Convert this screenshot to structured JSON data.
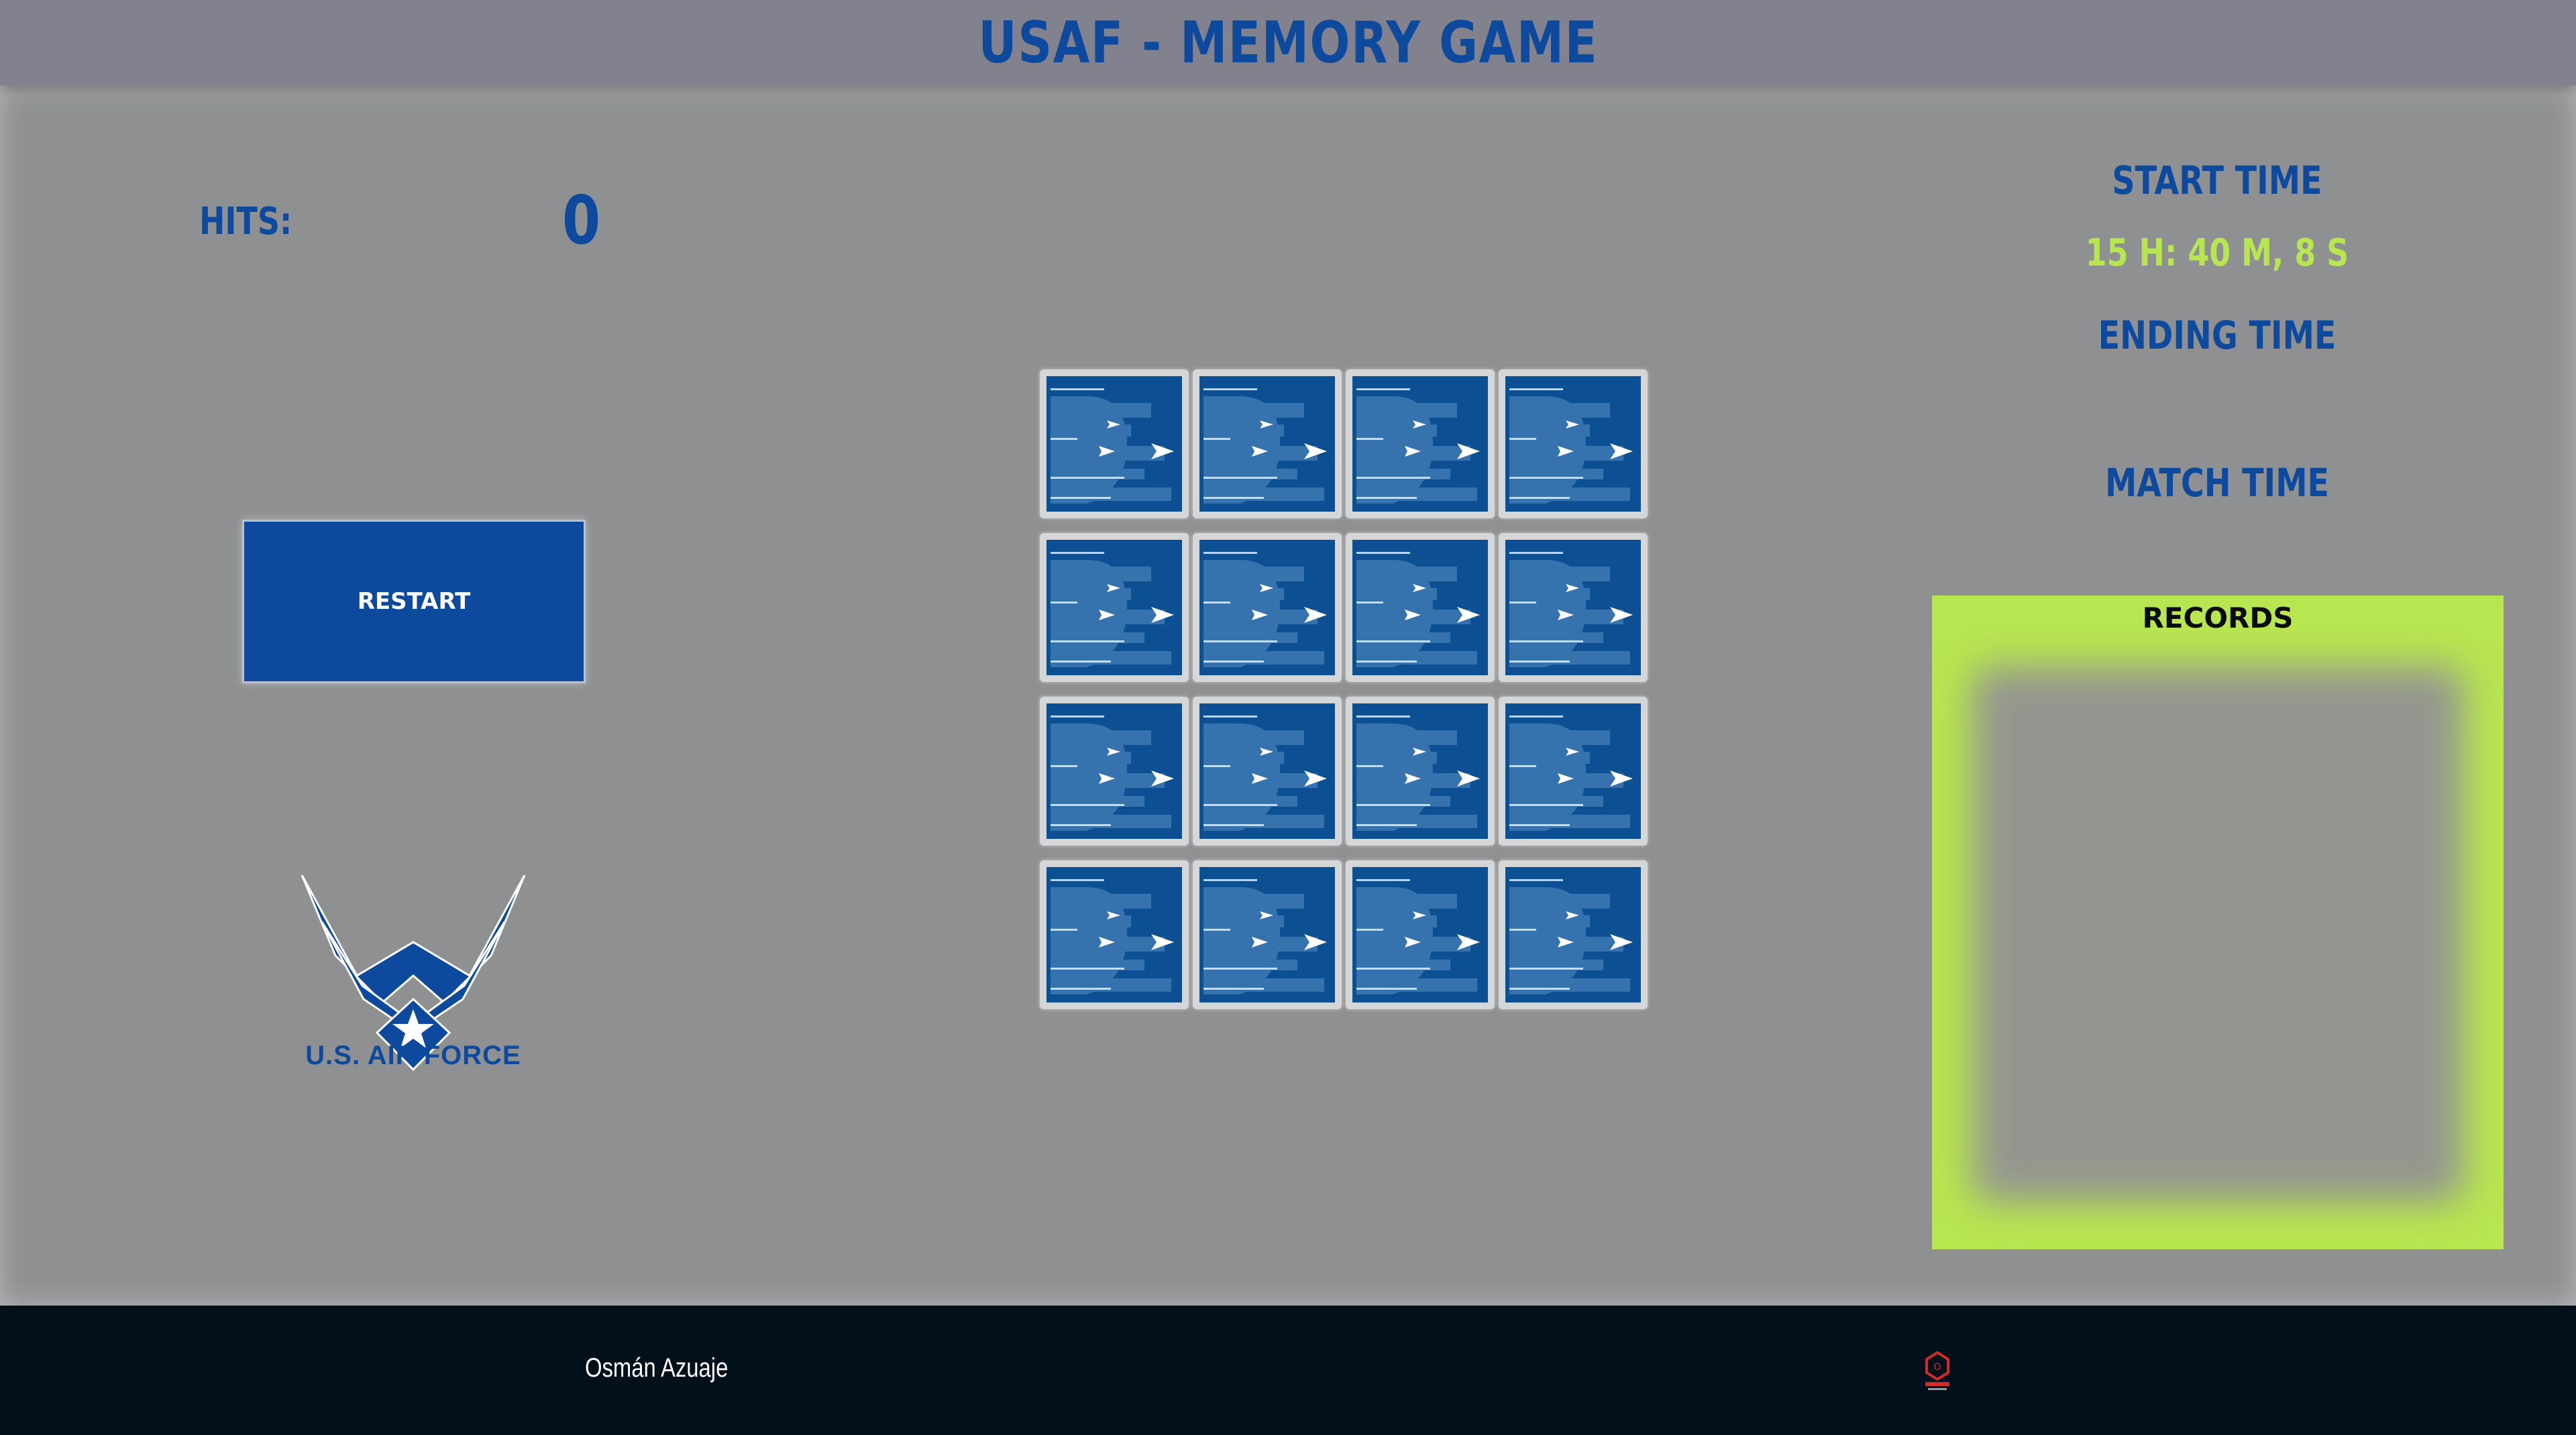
{
  "header": {
    "title": "USAF - MEMORY GAME"
  },
  "stats": {
    "hits_label": "HITS:",
    "hits_value": "0"
  },
  "controls": {
    "restart_label": "RESTART"
  },
  "branding": {
    "logo_text": "U.S. AIR FORCE",
    "logo_color": "#0d4a9e"
  },
  "board": {
    "rows": 4,
    "cols": 4,
    "cards_face_down": 16
  },
  "timing": {
    "start_label": "START TIME",
    "start_value": "15 H: 40 M, 8 S",
    "ending_label": "ENDING TIME",
    "ending_value": "",
    "match_label": "MATCH TIME",
    "match_value": ""
  },
  "records": {
    "title": "RECORDS",
    "items": []
  },
  "footer": {
    "author": "Osmán Azuaje",
    "logo_icon": "osman-logo-icon"
  },
  "colors": {
    "primary": "#0d4a9e",
    "accent": "#b8e650",
    "footer": "#01101a"
  }
}
